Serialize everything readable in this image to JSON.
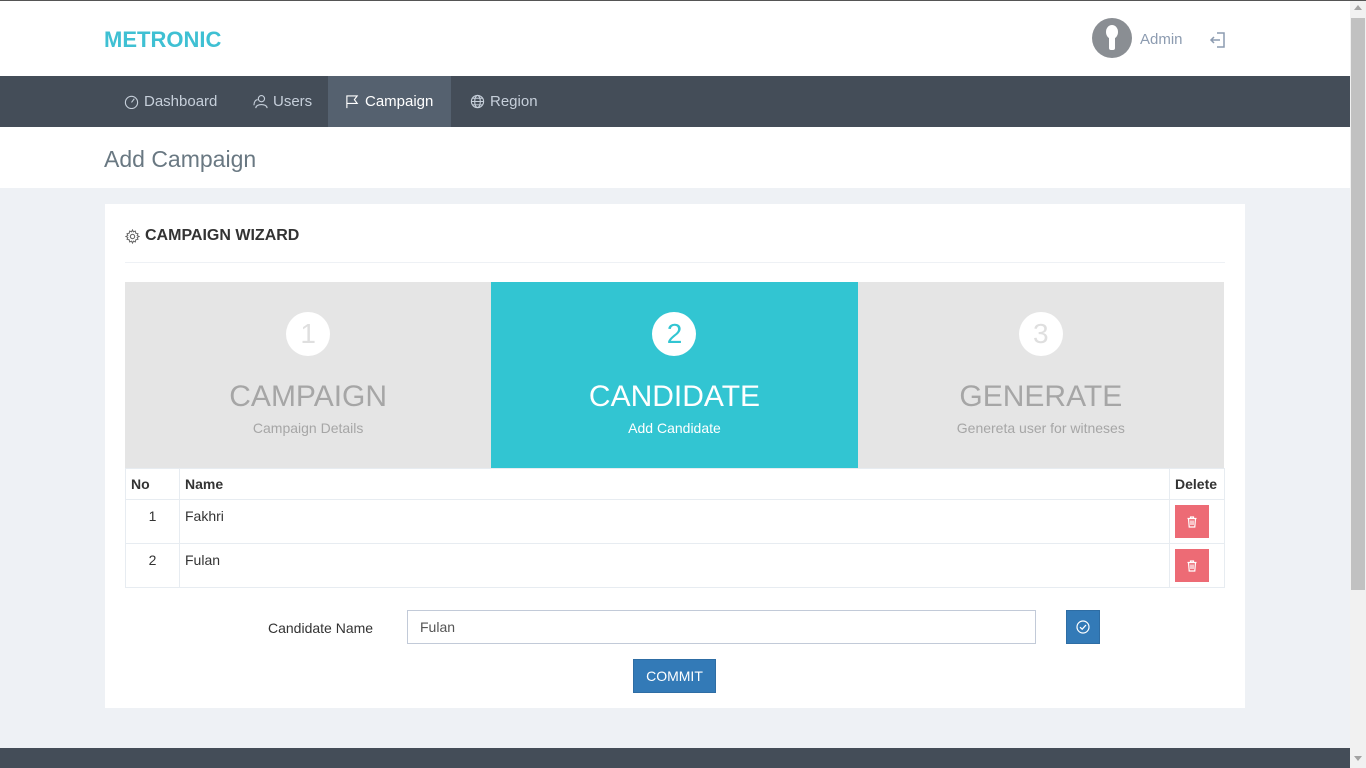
{
  "header": {
    "logo": "METRONIC",
    "user_name": "Admin"
  },
  "nav": {
    "items": [
      {
        "label": "Dashboard",
        "icon": "speedometer-icon",
        "active": false
      },
      {
        "label": "Users",
        "icon": "users-icon",
        "active": false
      },
      {
        "label": "Campaign",
        "icon": "flag-icon",
        "active": true
      },
      {
        "label": "Region",
        "icon": "globe-icon",
        "active": false
      }
    ]
  },
  "page": {
    "title": "Add Campaign"
  },
  "portlet": {
    "title": "CAMPAIGN WIZARD",
    "icon": "gear-icon"
  },
  "wizard": {
    "steps": [
      {
        "number": "1",
        "title": "CAMPAIGN",
        "description": "Campaign Details",
        "active": false
      },
      {
        "number": "2",
        "title": "CANDIDATE",
        "description": "Add Candidate",
        "active": true
      },
      {
        "number": "3",
        "title": "GENERATE",
        "description": "Genereta user for witneses",
        "active": false
      }
    ]
  },
  "table": {
    "columns": [
      "No",
      "Name",
      "Delete"
    ],
    "rows": [
      {
        "no": "1",
        "name": "Fakhri"
      },
      {
        "no": "2",
        "name": "Fulan"
      }
    ]
  },
  "form": {
    "label": "Candidate Name",
    "value": "Fulan",
    "commit_label": "COMMIT"
  },
  "colors": {
    "accent": "#32c5d2",
    "navbar": "#444d58",
    "primary": "#337ab7",
    "danger": "#ed6b75"
  }
}
